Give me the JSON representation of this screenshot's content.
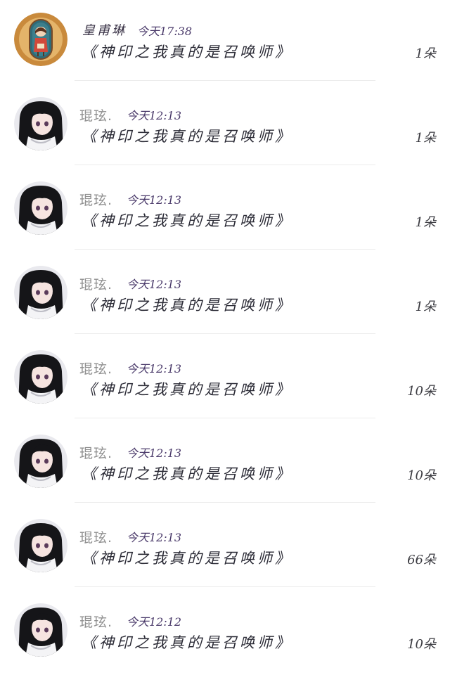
{
  "items": [
    {
      "name": "皇甫琳",
      "time": "今天17:38",
      "message": "《神印之我真的是召唤师》",
      "amount": "1朵",
      "avatar": "avatar-frame-doll-icon"
    },
    {
      "name": "琨玹.",
      "time": "今天12:13",
      "message": "《神印之我真的是召唤师》",
      "amount": "1朵",
      "avatar": "avatar-anime-girl-icon"
    },
    {
      "name": "琨玹.",
      "time": "今天12:13",
      "message": "《神印之我真的是召唤师》",
      "amount": "1朵",
      "avatar": "avatar-anime-girl-icon"
    },
    {
      "name": "琨玹.",
      "time": "今天12:13",
      "message": "《神印之我真的是召唤师》",
      "amount": "1朵",
      "avatar": "avatar-anime-girl-icon"
    },
    {
      "name": "琨玹.",
      "time": "今天12:13",
      "message": "《神印之我真的是召唤师》",
      "amount": "10朵",
      "avatar": "avatar-anime-girl-icon"
    },
    {
      "name": "琨玹.",
      "time": "今天12:13",
      "message": "《神印之我真的是召唤师》",
      "amount": "10朵",
      "avatar": "avatar-anime-girl-icon"
    },
    {
      "name": "琨玹.",
      "time": "今天12:13",
      "message": "《神印之我真的是召唤师》",
      "amount": "66朵",
      "avatar": "avatar-anime-girl-icon"
    },
    {
      "name": "琨玹.",
      "time": "今天12:12",
      "message": "《神印之我真的是召唤师》",
      "amount": "10朵",
      "avatar": "avatar-anime-girl-icon"
    }
  ],
  "colors": {
    "name_gray": "#8f8f8f",
    "time_purple": "#4a3a6a",
    "message_dark": "#2b2b36",
    "highlight_purple": "#6a2a78",
    "highlight_teal": "#4a8f86",
    "highlight_pink": "#b0407a",
    "divider": "#ececec"
  }
}
